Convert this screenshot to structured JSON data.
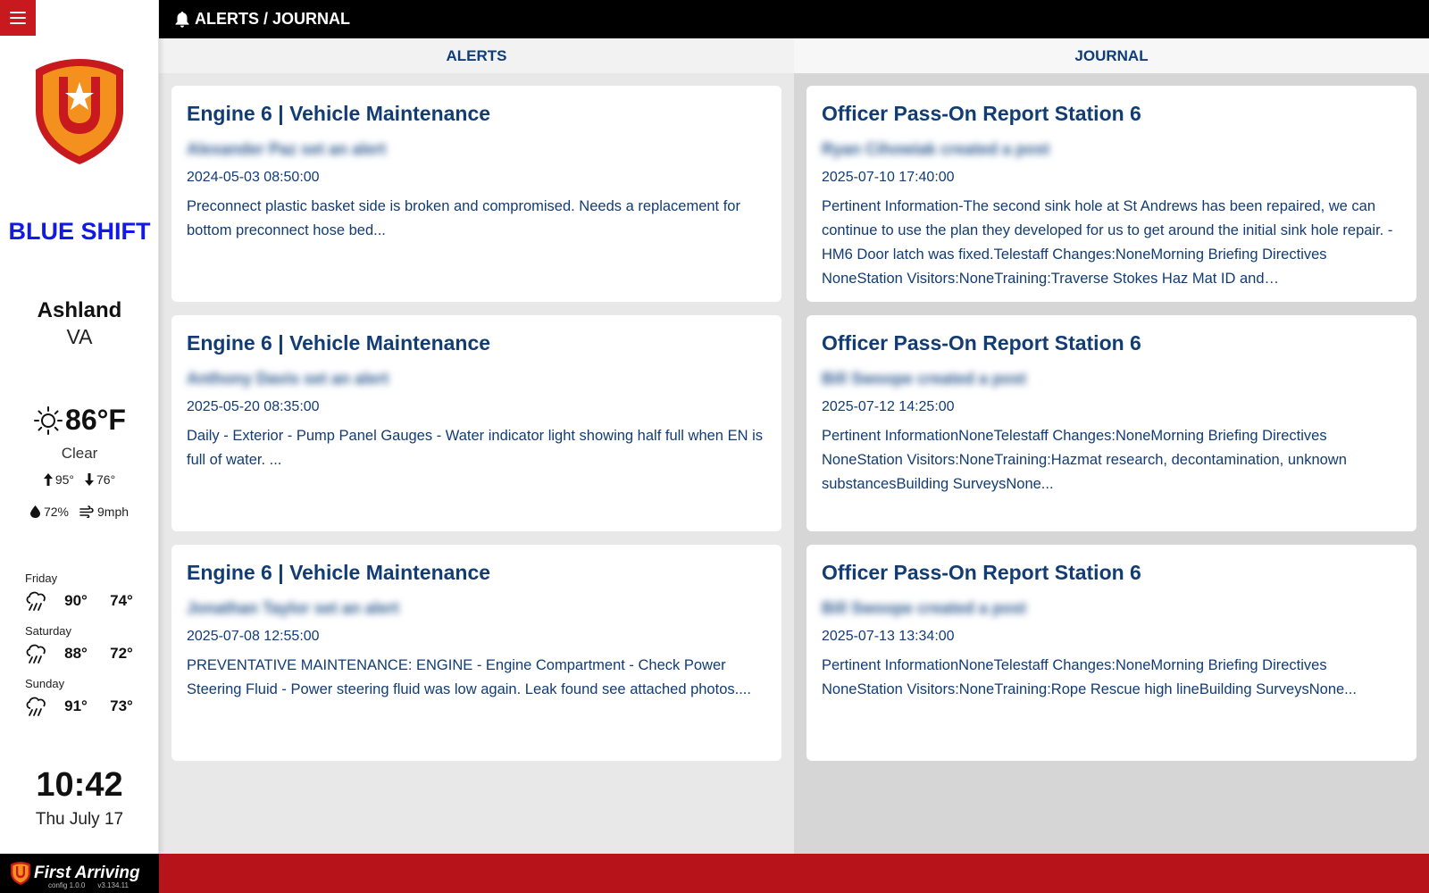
{
  "header": {
    "title": "ALERTS / JOURNAL"
  },
  "sidebar": {
    "shift": "BLUE SHIFT",
    "city": "Ashland",
    "state": "VA",
    "weather": {
      "temp": "86°F",
      "condition": "Clear",
      "high": "95°",
      "low": "76°",
      "humidity": "72%",
      "wind": "9mph"
    },
    "forecast": [
      {
        "day": "Friday",
        "high": "90°",
        "low": "74°",
        "icon": "rain-icon"
      },
      {
        "day": "Saturday",
        "high": "88°",
        "low": "72°",
        "icon": "rain-icon"
      },
      {
        "day": "Sunday",
        "high": "91°",
        "low": "73°",
        "icon": "rain-icon"
      }
    ],
    "time": "10:42",
    "date": "Thu July 17"
  },
  "alerts": {
    "heading": "ALERTS",
    "items": [
      {
        "title": "Engine 6 | Vehicle Maintenance",
        "author": "Alexander Paz set an alert",
        "timestamp": "2024-05-03 08:50:00",
        "body": "Preconnect plastic basket side is broken and compromised. Needs a replacement for bottom preconnect hose bed..."
      },
      {
        "title": "Engine 6 | Vehicle Maintenance",
        "author": "Anthony Davis set an alert",
        "timestamp": "2025-05-20 08:35:00",
        "body": "Daily - Exterior - Pump Panel Gauges - Water indicator light showing half full when EN is full of water. ..."
      },
      {
        "title": "Engine 6 | Vehicle Maintenance",
        "author": "Jonathan Taylor set an alert",
        "timestamp": "2025-07-08 12:55:00",
        "body": "PREVENTATIVE MAINTENANCE: ENGINE - Engine Compartment - Check Power Steering Fluid - Power steering fluid was low again. Leak found see attached photos...."
      }
    ]
  },
  "journal": {
    "heading": "JOURNAL",
    "items": [
      {
        "title": "Officer Pass-On Report Station 6",
        "author": "Ryan Cihowiak created a post",
        "timestamp": "2025-07-10 17:40:00",
        "body": "Pertinent Information-The second sink hole at St Andrews has been repaired, we can continue to use the plan they developed for us to get around the initial sink hole repair. -HM6 Door latch was fixed.Telestaff Changes:NoneMorning Briefing Directives NoneStation Visitors:NoneTraining:Traverse Stokes Haz Mat ID and…"
      },
      {
        "title": "Officer Pass-On Report Station 6",
        "author": "Bill Swoope created a post",
        "timestamp": "2025-07-12 14:25:00",
        "body": "Pertinent InformationNoneTelestaff Changes:NoneMorning Briefing Directives NoneStation Visitors:NoneTraining:Hazmat research, decontamination, unknown substancesBuilding SurveysNone..."
      },
      {
        "title": "Officer Pass-On Report Station 6",
        "author": "Bill Swoope created a post",
        "timestamp": "2025-07-13 13:34:00",
        "body": "Pertinent InformationNoneTelestaff Changes:NoneMorning Briefing Directives NoneStation Visitors:NoneTraining:Rope Rescue high lineBuilding SurveysNone..."
      }
    ]
  },
  "footer": {
    "brand": "First Arriving",
    "config": "config 1.0.0",
    "version": "v3.134.11"
  },
  "colors": {
    "accent_red": "#c8191f",
    "shift_blue": "#1219e6",
    "title_navy": "#123c74",
    "shield_orange": "#f4911e"
  }
}
